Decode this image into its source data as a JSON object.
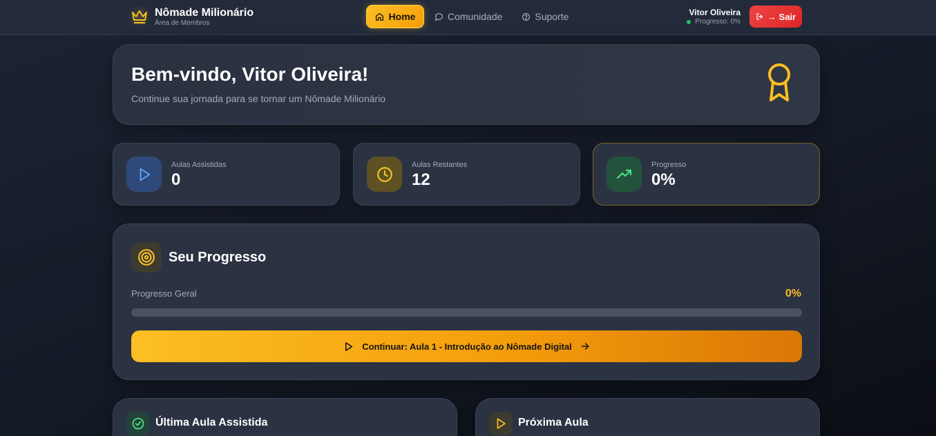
{
  "header": {
    "brand_title": "Nômade Milionário",
    "brand_subtitle": "Área de Membros",
    "nav": {
      "home": "Home",
      "community": "Comunidade",
      "support": "Suporte"
    },
    "user_name": "Vitor Oliveira",
    "user_progress": "Progresso: 0%",
    "logout_label": "→ Sair"
  },
  "welcome": {
    "title": "Bem-vindo, Vitor Oliveira!",
    "subtitle": "Continue sua jornada para se tornar um Nômade Milionário"
  },
  "stats": [
    {
      "label": "Aulas Assistidas",
      "value": "0"
    },
    {
      "label": "Aulas Restantes",
      "value": "12"
    },
    {
      "label": "Progresso",
      "value": "0%"
    }
  ],
  "progress": {
    "title": "Seu Progresso",
    "label": "Progresso Geral",
    "percent_text": "0%",
    "fraction": 0,
    "continue_label": "Continuar: Aula 1 - Introdução ao Nômade Digital"
  },
  "last_lesson": {
    "title": "Última Aula Assistida"
  },
  "next_lesson": {
    "title": "Próxima Aula"
  },
  "colors": {
    "accent": "#fbbf24",
    "danger": "#ef4444",
    "success": "#22c55e",
    "card": "#2b3342"
  },
  "icons": [
    "crown-icon",
    "home-icon",
    "chat-icon",
    "help-circle-icon",
    "logout-icon",
    "award-icon",
    "play-icon",
    "clock-icon",
    "trending-up-icon",
    "target-icon",
    "arrow-right-icon",
    "check-circle-icon"
  ]
}
